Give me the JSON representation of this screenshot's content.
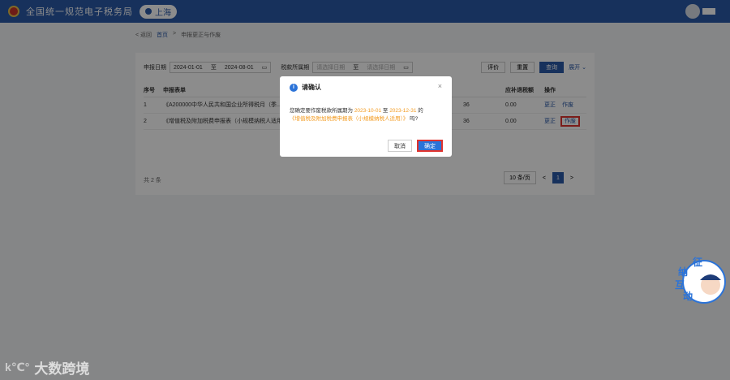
{
  "header": {
    "app_title": "全国统一规范电子税务局",
    "region": "上海"
  },
  "breadcrumb": {
    "back": "< 返回",
    "home": "首页",
    "current": "申报更正与作废"
  },
  "filters": {
    "declare_date_label": "申报日期",
    "date_start": "2024-01-01",
    "date_sep": "至",
    "date_end": "2024-08-01",
    "period_label": "税款所属期",
    "period_start_ph": "请选择日期",
    "period_end_ph": "请选择日期"
  },
  "toolbar": {
    "eval_label": "评价",
    "reset_label": "重置",
    "query_label": "查询",
    "expand_label": "展开"
  },
  "table": {
    "headers": [
      "序号",
      "申报表单",
      "应补退税额",
      "操作"
    ],
    "rows": [
      {
        "no": "1",
        "form": "《A200000中华人民共和国企业所得税月（季...",
        "mid": "36",
        "amount": "0.00",
        "op1": "更正",
        "op2": "作废"
      },
      {
        "no": "2",
        "form": "《增值税及附加税费申报表（小规模纳税人适用...",
        "mid": "36",
        "amount": "0.00",
        "op1": "更正",
        "op2": "作废"
      }
    ]
  },
  "pager": {
    "total": "共 2 条",
    "page_size": "10 条/页",
    "prev": "<",
    "current_page": "1",
    "next": ">"
  },
  "dialog": {
    "title": "请确认",
    "msg_prefix": "您确定要作废税款所属期为",
    "date_from": "2023-10-01",
    "msg_to": "至",
    "date_to": "2023-12-31",
    "msg_of": "的",
    "form_name": "《增值税及附加税费申报表（小规模纳税人适用）》",
    "msg_suffix": "吗?",
    "cancel_label": "取消",
    "ok_label": "确定"
  },
  "mascot": {
    "chars": [
      "征",
      "纳",
      "互",
      "动"
    ]
  },
  "watermark": {
    "logo": "k℃°",
    "text": "大数跨境"
  },
  "colors": {
    "brand": "#2b5aa8",
    "highlight": "#e0332e",
    "accent_text": "#f39a1e"
  }
}
